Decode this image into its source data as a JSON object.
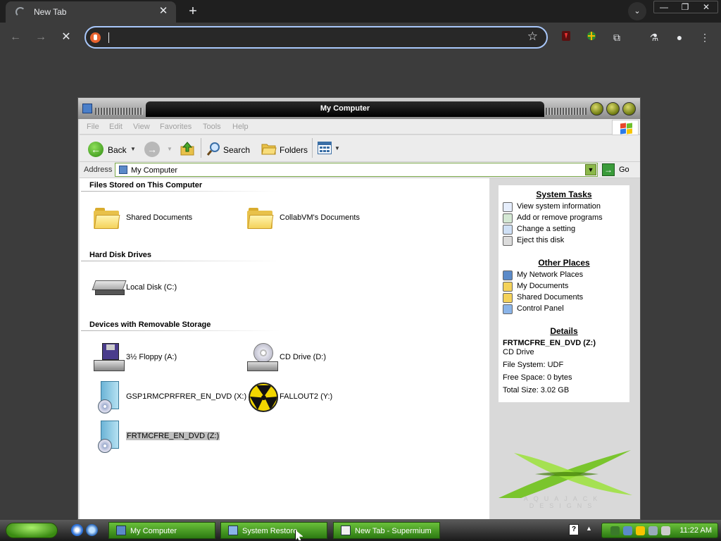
{
  "browser": {
    "tab": {
      "title": "New Tab",
      "close_glyph": "✕",
      "spinner_icon": "loading-spinner-icon"
    },
    "new_tab_glyph": "+",
    "tab_search_glyph": "⌄",
    "window_controls": {
      "minimize": "—",
      "maximize": "❐",
      "close": "✕"
    },
    "nav": {
      "back": "←",
      "forward": "→",
      "stop": "✕"
    },
    "omnibox": {
      "value": "",
      "placeholder": "",
      "star_glyph": "☆"
    },
    "extensions": {
      "puzzle": "⧉",
      "labs": "⚗",
      "profile": "●",
      "menu": "⋮"
    },
    "colors": {
      "omnibox_focus": "#a8c7fa",
      "frame": "#1f1f1f",
      "toolbar": "#3c3c3c"
    }
  },
  "xp_window": {
    "title": "My Computer",
    "menu": [
      "File",
      "Edit",
      "View",
      "Favorites",
      "Tools",
      "Help"
    ],
    "toolbar": {
      "back": "Back",
      "search": "Search",
      "folders": "Folders"
    },
    "address": {
      "label": "Address",
      "value": "My Computer",
      "go": "Go"
    },
    "groups": {
      "files_stored": {
        "title": "Files Stored on This Computer",
        "items": [
          "Shared Documents",
          "CollabVM's Documents"
        ]
      },
      "hard_disks": {
        "title": "Hard Disk Drives",
        "items": [
          "Local Disk (C:)"
        ]
      },
      "removable": {
        "title": "Devices with Removable Storage",
        "items": [
          "3½ Floppy (A:)",
          "CD Drive (D:)",
          "GSP1RMCPRFRER_EN_DVD (X:)",
          "FALLOUT2 (Y:)",
          "FRTMCFRE_EN_DVD (Z:)"
        ],
        "selected": "FRTMCFRE_EN_DVD (Z:)"
      }
    },
    "task_pane": {
      "system_tasks": {
        "title": "System Tasks",
        "items": [
          "View system information",
          "Add or remove programs",
          "Change a setting",
          "Eject this disk"
        ]
      },
      "other_places": {
        "title": "Other Places",
        "items": [
          "My Network Places",
          "My Documents",
          "Shared Documents",
          "Control Panel"
        ]
      },
      "details": {
        "title": "Details",
        "name": "FRTMCFRE_EN_DVD (Z:)",
        "type": "CD Drive",
        "file_system": "File System: UDF",
        "free_space": "Free Space: 0 bytes",
        "total_size": "Total Size: 3.02 GB"
      },
      "brand": "AQUAJACK DESIGNS"
    },
    "colors": {
      "accent_green": "#7ad414",
      "titlebar": "#000000",
      "task_pane": "#d9d9d9"
    }
  },
  "taskbar": {
    "tasks": [
      "My Computer",
      "System Restore",
      "New Tab - Supermium"
    ],
    "clock": "11:22 AM",
    "help_glyph": "?",
    "chevron": "▲"
  }
}
